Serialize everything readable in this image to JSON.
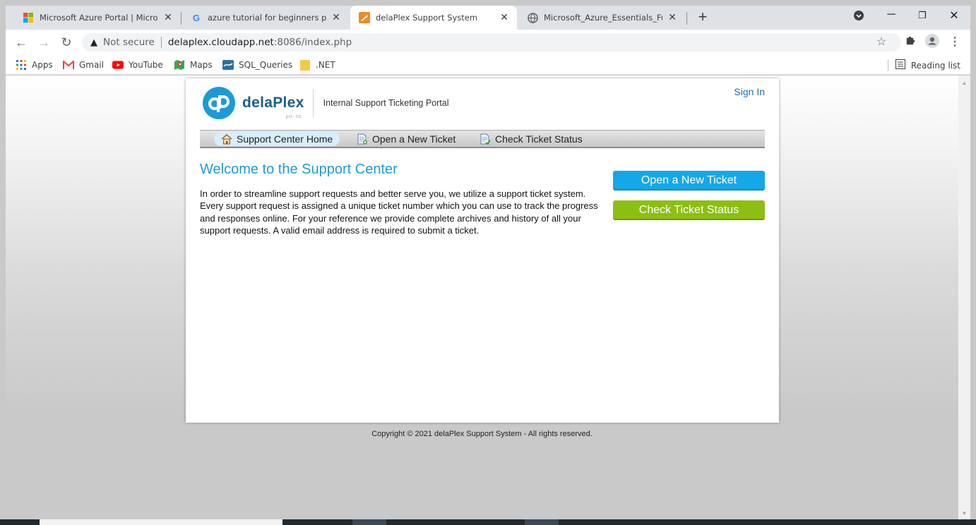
{
  "browser": {
    "tabs": [
      {
        "title": "Microsoft Azure Portal | Microsof",
        "icon": "microsoft-logo-icon",
        "active": false
      },
      {
        "title": "azure tutorial for beginners pdf -",
        "icon": "google-logo-icon",
        "active": false
      },
      {
        "title": "delaPlex Support System",
        "icon": "osticket-icon",
        "active": true
      },
      {
        "title": "Microsoft_Azure_Essentials_Fund",
        "icon": "globe-icon",
        "active": false
      }
    ],
    "address": {
      "security_label": "Not secure",
      "host": "delaplex.cloudapp.net",
      "path": ":8086/index.php"
    },
    "bookmarks": [
      {
        "label": "Apps",
        "icon": "apps-grid-icon"
      },
      {
        "label": "Gmail",
        "icon": "gmail-icon"
      },
      {
        "label": "YouTube",
        "icon": "youtube-icon"
      },
      {
        "label": "Maps",
        "icon": "maps-icon"
      },
      {
        "label": "SQL_Queries",
        "icon": "sql-bookmark-icon"
      },
      {
        "label": ".NET",
        "icon": "folder-icon"
      }
    ],
    "reading_list": "Reading list"
  },
  "site": {
    "brand": "delaPlex",
    "brand_sub": "pvt. ltd.",
    "tagline": "Internal Support Ticketing Portal",
    "signin": "Sign In",
    "nav": [
      {
        "label": "Support Center Home",
        "icon": "home-icon"
      },
      {
        "label": "Open a New Ticket",
        "icon": "new-ticket-icon"
      },
      {
        "label": "Check Ticket Status",
        "icon": "ticket-status-icon"
      }
    ],
    "welcome_title": "Welcome to the Support Center",
    "intro": "In order to streamline support requests and better serve you, we utilize a support ticket system. Every support request is assigned a unique ticket number which you can use to track the progress and responses online. For your reference we provide complete archives and history of all your support requests. A valid email address is required to submit a ticket.",
    "cta_open": "Open a New Ticket",
    "cta_check": "Check Ticket Status",
    "copyright": "Copyright © 2021 delaPlex Support System - All rights reserved."
  },
  "colors": {
    "accent_blue": "#14a8e9",
    "accent_green": "#8cbf12",
    "title_blue": "#1e9bd6"
  }
}
